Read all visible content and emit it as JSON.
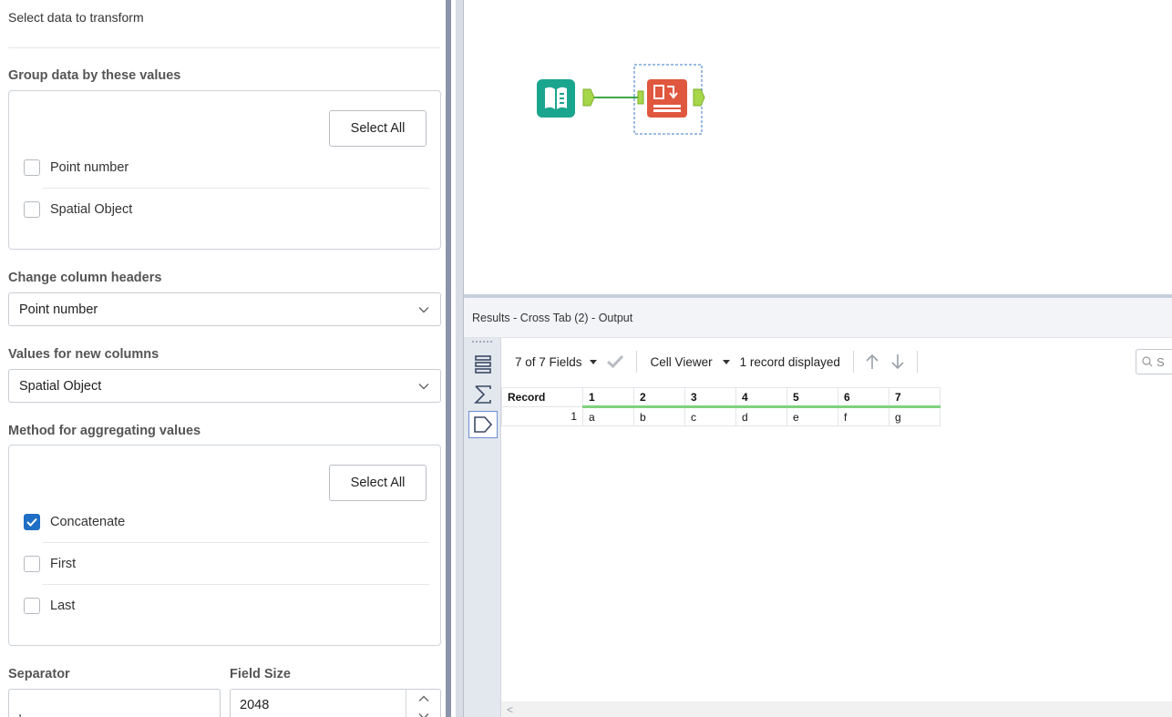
{
  "config": {
    "select_data_label": "Select data to transform",
    "group_by": {
      "title": "Group data by these values",
      "select_all": "Select All",
      "options": [
        {
          "label": "Point number",
          "checked": false
        },
        {
          "label": "Spatial Object",
          "checked": false
        }
      ]
    },
    "column_headers": {
      "title": "Change column headers",
      "value": "Point number"
    },
    "new_columns": {
      "title": "Values for new columns",
      "value": "Spatial Object"
    },
    "aggregation": {
      "title": "Method for aggregating values",
      "select_all": "Select All",
      "options": [
        {
          "label": "Concatenate",
          "checked": true
        },
        {
          "label": "First",
          "checked": false
        },
        {
          "label": "Last",
          "checked": false
        }
      ]
    },
    "separator": {
      "title": "Separator",
      "value": ","
    },
    "field_size": {
      "title": "Field Size",
      "value": "2048"
    }
  },
  "canvas": {
    "tools": [
      {
        "name": "Input Data",
        "icon": "input-book-icon",
        "color": "#1aa58e",
        "selected": false
      },
      {
        "name": "Cross Tab",
        "icon": "cross-tab-icon",
        "color": "#e0573f",
        "selected": true
      }
    ]
  },
  "results": {
    "header": "Results - Cross Tab (2) - Output",
    "fields": "7 of 7 Fields",
    "viewer": "Cell Viewer",
    "records": "1 record displayed",
    "search_placeholder": "S",
    "columns": [
      "Record",
      "1",
      "2",
      "3",
      "4",
      "5",
      "6",
      "7"
    ],
    "rows": [
      [
        "1",
        "a",
        "b",
        "c",
        "d",
        "e",
        "f",
        "g"
      ]
    ]
  },
  "colors": {
    "accent": "#1f6fc5",
    "splitter": "#8b94a8",
    "header_underline": "#7ed27e"
  }
}
